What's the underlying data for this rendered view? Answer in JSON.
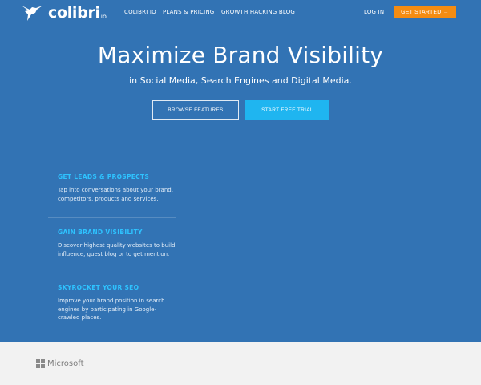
{
  "brand": {
    "name": "colibri",
    "suffix": "io"
  },
  "nav": {
    "links": [
      "COLIBRI IO",
      "PLANS & PRICING",
      "GROWTH HACKING BLOG"
    ],
    "login": "LOG IN",
    "cta": "GET STARTED →"
  },
  "hero": {
    "title": "Maximize Brand Visibility",
    "subtitle": "in Social Media, Search Engines and Digital Media.",
    "browse_label": "BROWSE FEATURES",
    "trial_label": "START FREE TRIAL"
  },
  "features": [
    {
      "title": "GET LEADS & PROSPECTS",
      "text": "Tap into conversations about your brand, competitors, products and services."
    },
    {
      "title": "GAIN BRAND VISIBILITY",
      "text": "Discover highest quality websites to build influence, guest blog or to get mention."
    },
    {
      "title": "SKYROCKET YOUR SEO",
      "text": "Improve your brand position in search engines by participating in Google-crawled places."
    }
  ],
  "clients": {
    "microsoft": "Microsoft"
  },
  "colors": {
    "hero_bg": "#3273b4",
    "accent": "#1fb5f0",
    "cta": "#f48c12",
    "feature_title": "#2ec3ff"
  },
  "icons": {
    "logo": "hummingbird-icon",
    "microsoft": "microsoft-logo-icon"
  }
}
